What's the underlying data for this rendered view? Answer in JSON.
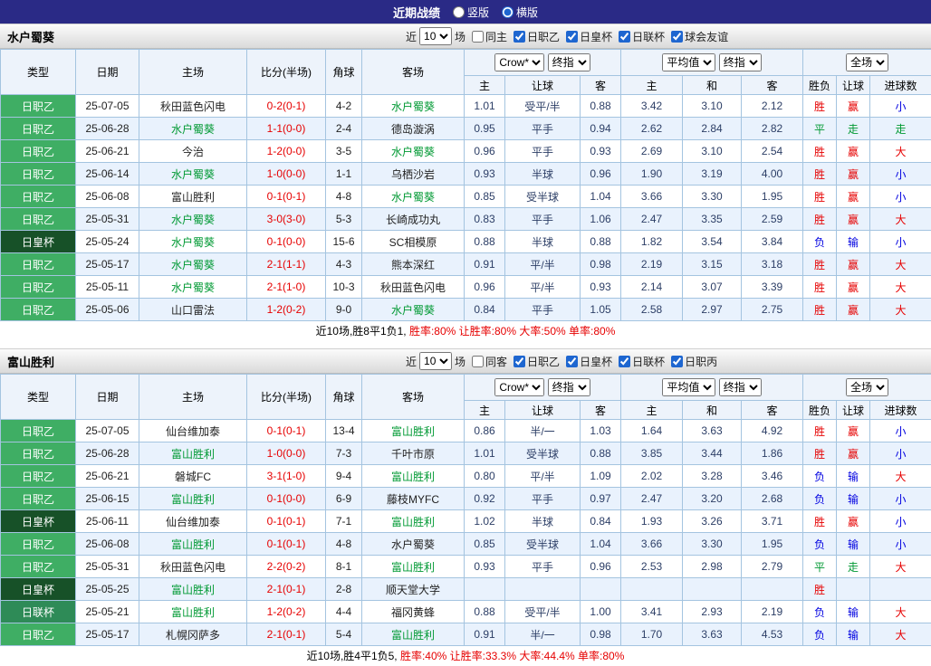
{
  "topbar": {
    "title": "近期战绩",
    "layout_options": [
      {
        "label": "竖版",
        "checked": false
      },
      {
        "label": "横版",
        "checked": true
      }
    ]
  },
  "league_colors": {
    "日职乙": "#3fae64",
    "日皇杯": "#175128",
    "日联杯": "#2e8b57"
  },
  "result_colors": {
    "胜": "#e60000",
    "平": "#009933",
    "负": "#0000e0",
    "赢": "#e60000",
    "走": "#009933",
    "输": "#0000e0",
    "大": "#e60000",
    "小": "#0000e0"
  },
  "sections": [
    {
      "team": "水户蜀葵",
      "filter": {
        "near_label": "近",
        "games": "10",
        "games_suffix": "场",
        "same": {
          "label": "同主",
          "checked": false
        },
        "leagues": [
          {
            "label": "日职乙",
            "checked": true
          },
          {
            "label": "日皇杯",
            "checked": true
          },
          {
            "label": "日联杯",
            "checked": true
          },
          {
            "label": "球会友谊",
            "checked": true
          }
        ]
      },
      "table": {
        "columns": [
          "类型",
          "日期",
          "主场",
          "比分(半场)",
          "角球",
          "客场"
        ],
        "odds_group": {
          "bookmaker": "Crow*",
          "stage": "终指",
          "sub": [
            "主",
            "让球",
            "客"
          ]
        },
        "avg_group": {
          "name": "平均值",
          "stage": "终指",
          "sub": [
            "主",
            "和",
            "客"
          ]
        },
        "result_group": {
          "scope": "全场",
          "sub": [
            "胜负",
            "让球",
            "进球数"
          ]
        },
        "rows": [
          {
            "league": "日职乙",
            "date": "25-07-05",
            "home": "秋田蓝色闪电",
            "score": "0-2(0-1)",
            "corner": "4-2",
            "away": "水户蜀葵",
            "odds": [
              "1.01",
              "受平/半",
              "0.88"
            ],
            "avg": [
              "3.42",
              "3.10",
              "2.12"
            ],
            "results": [
              "胜",
              "赢",
              "小"
            ]
          },
          {
            "league": "日职乙",
            "date": "25-06-28",
            "home": "水户蜀葵",
            "score": "1-1(0-0)",
            "corner": "2-4",
            "away": "德岛漩涡",
            "odds": [
              "0.95",
              "平手",
              "0.94"
            ],
            "avg": [
              "2.62",
              "2.84",
              "2.82"
            ],
            "results": [
              "平",
              "走",
              "走"
            ]
          },
          {
            "league": "日职乙",
            "date": "25-06-21",
            "home": "今治",
            "score": "1-2(0-0)",
            "corner": "3-5",
            "away": "水户蜀葵",
            "odds": [
              "0.96",
              "平手",
              "0.93"
            ],
            "avg": [
              "2.69",
              "3.10",
              "2.54"
            ],
            "results": [
              "胜",
              "赢",
              "大"
            ]
          },
          {
            "league": "日职乙",
            "date": "25-06-14",
            "home": "水户蜀葵",
            "score": "1-0(0-0)",
            "corner": "1-1",
            "away": "乌栖沙岩",
            "odds": [
              "0.93",
              "半球",
              "0.96"
            ],
            "avg": [
              "1.90",
              "3.19",
              "4.00"
            ],
            "results": [
              "胜",
              "赢",
              "小"
            ]
          },
          {
            "league": "日职乙",
            "date": "25-06-08",
            "home": "富山胜利",
            "score": "0-1(0-1)",
            "corner": "4-8",
            "away": "水户蜀葵",
            "odds": [
              "0.85",
              "受半球",
              "1.04"
            ],
            "avg": [
              "3.66",
              "3.30",
              "1.95"
            ],
            "results": [
              "胜",
              "赢",
              "小"
            ]
          },
          {
            "league": "日职乙",
            "date": "25-05-31",
            "home": "水户蜀葵",
            "score": "3-0(3-0)",
            "corner": "5-3",
            "away": "长崎成功丸",
            "odds": [
              "0.83",
              "平手",
              "1.06"
            ],
            "avg": [
              "2.47",
              "3.35",
              "2.59"
            ],
            "results": [
              "胜",
              "赢",
              "大"
            ]
          },
          {
            "league": "日皇杯",
            "date": "25-05-24",
            "home": "水户蜀葵",
            "score": "0-1(0-0)",
            "corner": "15-6",
            "away": "SC相模原",
            "odds": [
              "0.88",
              "半球",
              "0.88"
            ],
            "avg": [
              "1.82",
              "3.54",
              "3.84"
            ],
            "results": [
              "负",
              "输",
              "小"
            ]
          },
          {
            "league": "日职乙",
            "date": "25-05-17",
            "home": "水户蜀葵",
            "score": "2-1(1-1)",
            "corner": "4-3",
            "away": "熊本深红",
            "odds": [
              "0.91",
              "平/半",
              "0.98"
            ],
            "avg": [
              "2.19",
              "3.15",
              "3.18"
            ],
            "results": [
              "胜",
              "赢",
              "大"
            ]
          },
          {
            "league": "日职乙",
            "date": "25-05-11",
            "home": "水户蜀葵",
            "score": "2-1(1-0)",
            "corner": "10-3",
            "away": "秋田蓝色闪电",
            "odds": [
              "0.96",
              "平/半",
              "0.93"
            ],
            "avg": [
              "2.14",
              "3.07",
              "3.39"
            ],
            "results": [
              "胜",
              "赢",
              "大"
            ]
          },
          {
            "league": "日职乙",
            "date": "25-05-06",
            "home": "山口雷法",
            "score": "1-2(0-2)",
            "corner": "9-0",
            "away": "水户蜀葵",
            "odds": [
              "0.84",
              "平手",
              "1.05"
            ],
            "avg": [
              "2.58",
              "2.97",
              "2.75"
            ],
            "results": [
              "胜",
              "赢",
              "大"
            ]
          }
        ]
      },
      "summary": {
        "record": "近10场,胜8平1负1, ",
        "stats": "胜率:80% 让胜率:80% 大率:50% 单率:80%"
      }
    },
    {
      "team": "富山胜利",
      "filter": {
        "near_label": "近",
        "games": "10",
        "games_suffix": "场",
        "same": {
          "label": "同客",
          "checked": false
        },
        "leagues": [
          {
            "label": "日职乙",
            "checked": true
          },
          {
            "label": "日皇杯",
            "checked": true
          },
          {
            "label": "日联杯",
            "checked": true
          },
          {
            "label": "日职丙",
            "checked": true
          }
        ]
      },
      "table": {
        "columns": [
          "类型",
          "日期",
          "主场",
          "比分(半场)",
          "角球",
          "客场"
        ],
        "odds_group": {
          "bookmaker": "Crow*",
          "stage": "终指",
          "sub": [
            "主",
            "让球",
            "客"
          ]
        },
        "avg_group": {
          "name": "平均值",
          "stage": "终指",
          "sub": [
            "主",
            "和",
            "客"
          ]
        },
        "result_group": {
          "scope": "全场",
          "sub": [
            "胜负",
            "让球",
            "进球数"
          ]
        },
        "rows": [
          {
            "league": "日职乙",
            "date": "25-07-05",
            "home": "仙台维加泰",
            "score": "0-1(0-1)",
            "corner": "13-4",
            "away": "富山胜利",
            "odds": [
              "0.86",
              "半/一",
              "1.03"
            ],
            "avg": [
              "1.64",
              "3.63",
              "4.92"
            ],
            "results": [
              "胜",
              "赢",
              "小"
            ]
          },
          {
            "league": "日职乙",
            "date": "25-06-28",
            "home": "富山胜利",
            "score": "1-0(0-0)",
            "corner": "7-3",
            "away": "千叶市原",
            "odds": [
              "1.01",
              "受半球",
              "0.88"
            ],
            "avg": [
              "3.85",
              "3.44",
              "1.86"
            ],
            "results": [
              "胜",
              "赢",
              "小"
            ]
          },
          {
            "league": "日职乙",
            "date": "25-06-21",
            "home": "磐城FC",
            "score": "3-1(1-0)",
            "corner": "9-4",
            "away": "富山胜利",
            "odds": [
              "0.80",
              "平/半",
              "1.09"
            ],
            "avg": [
              "2.02",
              "3.28",
              "3.46"
            ],
            "results": [
              "负",
              "输",
              "大"
            ]
          },
          {
            "league": "日职乙",
            "date": "25-06-15",
            "home": "富山胜利",
            "score": "0-1(0-0)",
            "corner": "6-9",
            "away": "藤枝MYFC",
            "odds": [
              "0.92",
              "平手",
              "0.97"
            ],
            "avg": [
              "2.47",
              "3.20",
              "2.68"
            ],
            "results": [
              "负",
              "输",
              "小"
            ]
          },
          {
            "league": "日皇杯",
            "date": "25-06-11",
            "home": "仙台维加泰",
            "score": "0-1(0-1)",
            "corner": "7-1",
            "away": "富山胜利",
            "odds": [
              "1.02",
              "半球",
              "0.84"
            ],
            "avg": [
              "1.93",
              "3.26",
              "3.71"
            ],
            "results": [
              "胜",
              "赢",
              "小"
            ]
          },
          {
            "league": "日职乙",
            "date": "25-06-08",
            "home": "富山胜利",
            "score": "0-1(0-1)",
            "corner": "4-8",
            "away": "水户蜀葵",
            "odds": [
              "0.85",
              "受半球",
              "1.04"
            ],
            "avg": [
              "3.66",
              "3.30",
              "1.95"
            ],
            "results": [
              "负",
              "输",
              "小"
            ]
          },
          {
            "league": "日职乙",
            "date": "25-05-31",
            "home": "秋田蓝色闪电",
            "score": "2-2(0-2)",
            "corner": "8-1",
            "away": "富山胜利",
            "odds": [
              "0.93",
              "平手",
              "0.96"
            ],
            "avg": [
              "2.53",
              "2.98",
              "2.79"
            ],
            "results": [
              "平",
              "走",
              "大"
            ]
          },
          {
            "league": "日皇杯",
            "date": "25-05-25",
            "home": "富山胜利",
            "score": "2-1(0-1)",
            "corner": "2-8",
            "away": "顺天堂大学",
            "odds": [
              "",
              "",
              ""
            ],
            "avg": [
              "",
              "",
              ""
            ],
            "results": [
              "胜",
              "",
              ""
            ]
          },
          {
            "league": "日联杯",
            "date": "25-05-21",
            "home": "富山胜利",
            "score": "1-2(0-2)",
            "corner": "4-4",
            "away": "福冈黄蜂",
            "odds": [
              "0.88",
              "受平/半",
              "1.00"
            ],
            "avg": [
              "3.41",
              "2.93",
              "2.19"
            ],
            "results": [
              "负",
              "输",
              "大"
            ]
          },
          {
            "league": "日职乙",
            "date": "25-05-17",
            "home": "札幌冈萨多",
            "score": "2-1(0-1)",
            "corner": "5-4",
            "away": "富山胜利",
            "odds": [
              "0.91",
              "半/一",
              "0.98"
            ],
            "avg": [
              "1.70",
              "3.63",
              "4.53"
            ],
            "results": [
              "负",
              "输",
              "大"
            ]
          }
        ]
      },
      "summary": {
        "record": "近10场,胜4平1负5, ",
        "stats": "胜率:40% 让胜率:33.3% 大率:44.4% 单率:80%"
      }
    }
  ]
}
